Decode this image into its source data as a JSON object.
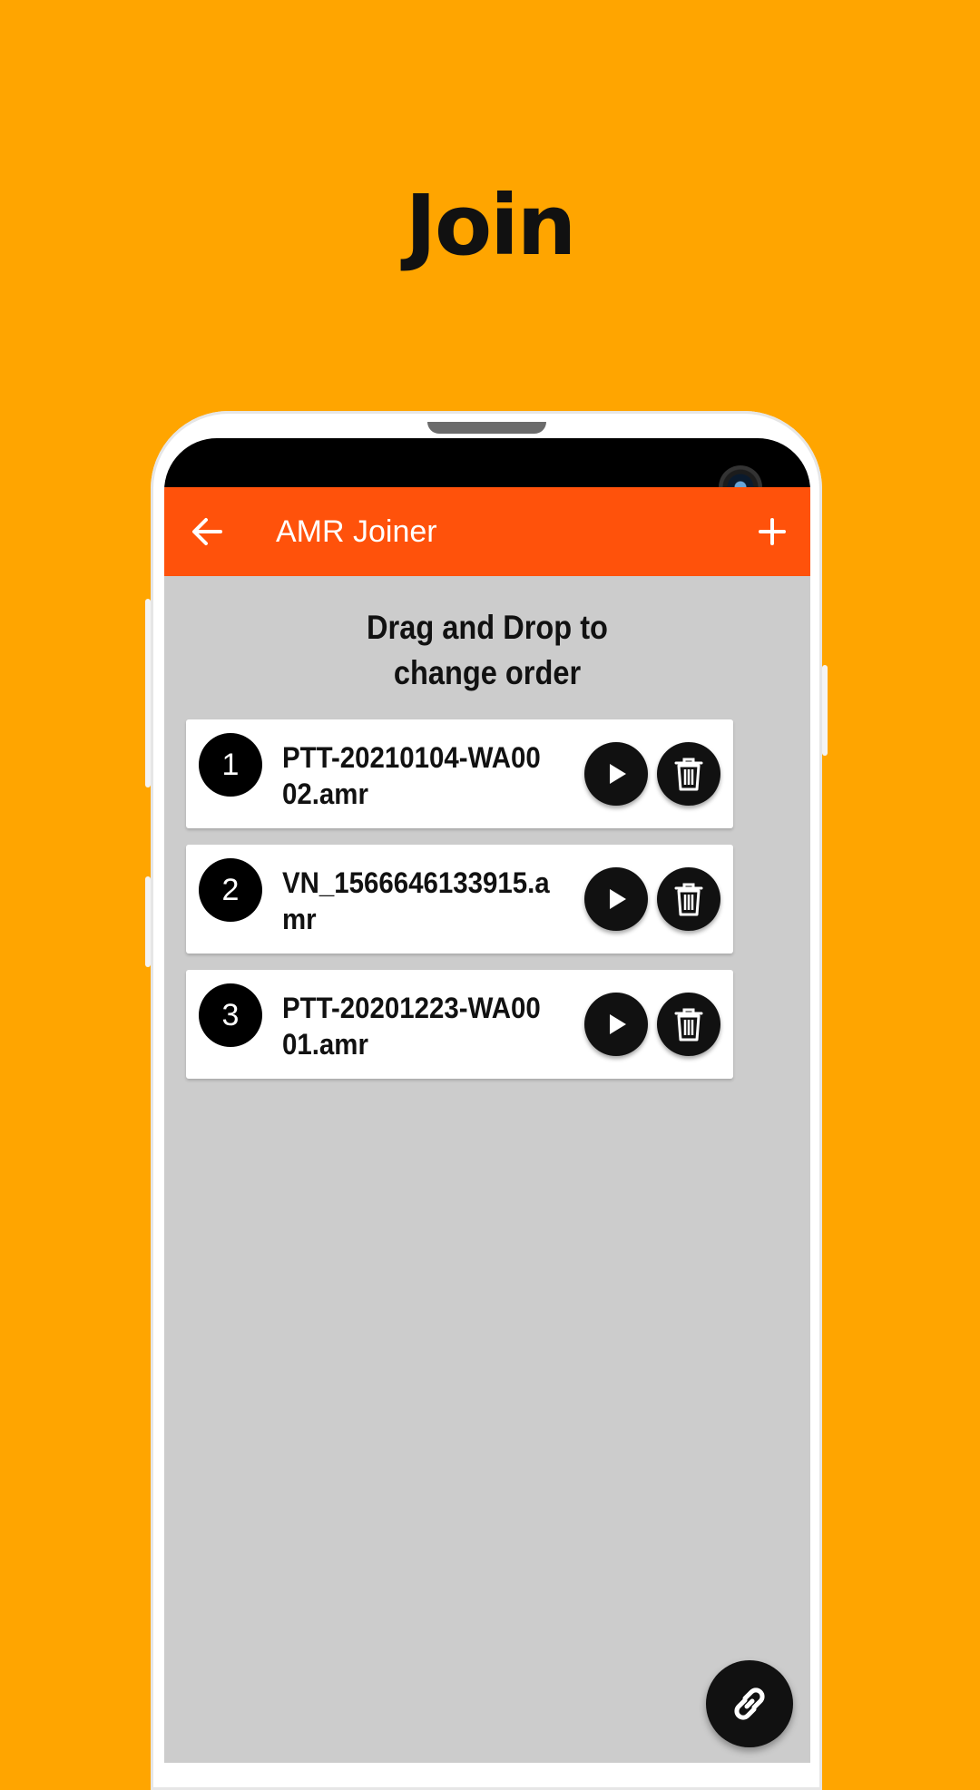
{
  "promo": {
    "title": "Join"
  },
  "app_bar": {
    "title": "AMR Joiner",
    "back_icon": "arrow-left-icon",
    "add_icon": "plus-icon",
    "color": "#FF520B"
  },
  "instruction": {
    "line1": "Drag and Drop to",
    "line2": "change order"
  },
  "files": [
    {
      "number": "1",
      "name": "PTT-20210104-WA0002.amr"
    },
    {
      "number": "2",
      "name": "VN_1566646133915.amr"
    },
    {
      "number": "3",
      "name": "PTT-20201223-WA0001.amr"
    }
  ],
  "fab": {
    "icon": "link-icon"
  },
  "colors": {
    "background": "#FFA500",
    "screen": "#cccccc",
    "card": "#ffffff",
    "button": "#111111"
  }
}
